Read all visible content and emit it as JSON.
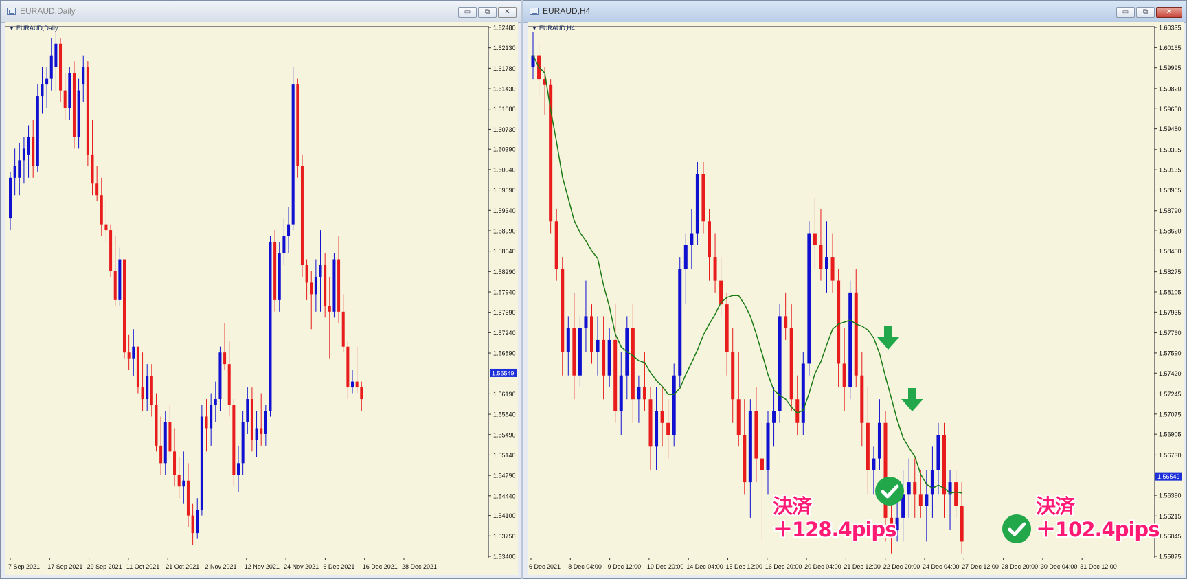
{
  "left_window": {
    "title": "EURAUD,Daily",
    "symbol_label": "EURAUD,Daily",
    "buttons": {
      "minimize": "▭",
      "maximize": "⧉",
      "close": "✕"
    }
  },
  "right_window": {
    "title": "EURAUD,H4",
    "symbol_label": "EURAUD,H4",
    "buttons": {
      "minimize": "▭",
      "maximize": "⧉",
      "close": "✕"
    }
  },
  "annotations": {
    "left": {
      "line1": "決済",
      "line2": "＋128.4pips"
    },
    "right": {
      "line1": "決済",
      "line2": "＋102.4pips"
    }
  },
  "colors": {
    "bull": "#1010d0",
    "bear": "#e81c1c",
    "ma": "#1a7a14",
    "bg": "#f6f4dc",
    "arrow": "#22a84a",
    "price_tag": "#1c2fd8"
  },
  "chart_data": [
    {
      "type": "candlestick",
      "title": "EURAUD,Daily",
      "current_price": "1.56549",
      "y_ticks": [
        "1.62480",
        "1.62130",
        "1.61780",
        "1.61430",
        "1.61080",
        "1.60730",
        "1.60390",
        "1.60040",
        "1.59690",
        "1.59340",
        "1.58990",
        "1.58640",
        "1.58290",
        "1.57940",
        "1.57590",
        "1.57240",
        "1.56890",
        "1.56549",
        "1.56190",
        "1.55840",
        "1.55490",
        "1.55140",
        "1.54790",
        "1.54440",
        "1.54100",
        "1.53750",
        "1.53400"
      ],
      "ylim": [
        1.534,
        1.6248
      ],
      "x_ticks": [
        "7 Sep 2021",
        "17 Sep 2021",
        "29 Sep 2021",
        "11 Oct 2021",
        "21 Oct 2021",
        "2 Nov 2021",
        "12 Nov 2021",
        "24 Nov 2021",
        "6 Dec 2021",
        "16 Dec 2021",
        "28 Dec 2021"
      ],
      "candles": [
        [
          1.592,
          1.6,
          1.59,
          1.599
        ],
        [
          1.599,
          1.604,
          1.596,
          1.601
        ],
        [
          1.599,
          1.605,
          1.596,
          1.602
        ],
        [
          1.602,
          1.606,
          1.598,
          1.604
        ],
        [
          1.603,
          1.608,
          1.599,
          1.606
        ],
        [
          1.606,
          1.609,
          1.599,
          1.601
        ],
        [
          1.601,
          1.615,
          1.6,
          1.613
        ],
        [
          1.613,
          1.618,
          1.61,
          1.615
        ],
        [
          1.615,
          1.618,
          1.611,
          1.616
        ],
        [
          1.616,
          1.623,
          1.614,
          1.62
        ],
        [
          1.618,
          1.624,
          1.614,
          1.622
        ],
        [
          1.622,
          1.623,
          1.612,
          1.614
        ],
        [
          1.614,
          1.617,
          1.609,
          1.611
        ],
        [
          1.611,
          1.618,
          1.609,
          1.617
        ],
        [
          1.617,
          1.619,
          1.604,
          1.606
        ],
        [
          1.606,
          1.616,
          1.604,
          1.614
        ],
        [
          1.615,
          1.62,
          1.612,
          1.618
        ],
        [
          1.618,
          1.619,
          1.601,
          1.603
        ],
        [
          1.603,
          1.609,
          1.596,
          1.598
        ],
        [
          1.598,
          1.601,
          1.595,
          1.596
        ],
        [
          1.596,
          1.599,
          1.589,
          1.591
        ],
        [
          1.591,
          1.595,
          1.588,
          1.59
        ],
        [
          1.59,
          1.591,
          1.582,
          1.583
        ],
        [
          1.583,
          1.589,
          1.577,
          1.578
        ],
        [
          1.578,
          1.587,
          1.577,
          1.585
        ],
        [
          1.585,
          1.585,
          1.568,
          1.569
        ],
        [
          1.569,
          1.572,
          1.566,
          1.568
        ],
        [
          1.568,
          1.573,
          1.565,
          1.57
        ],
        [
          1.57,
          1.57,
          1.562,
          1.563
        ],
        [
          1.563,
          1.569,
          1.559,
          1.561
        ],
        [
          1.561,
          1.567,
          1.559,
          1.565
        ],
        [
          1.565,
          1.567,
          1.558,
          1.56
        ],
        [
          1.56,
          1.562,
          1.552,
          1.553
        ],
        [
          1.553,
          1.558,
          1.548,
          1.55
        ],
        [
          1.55,
          1.559,
          1.548,
          1.557
        ],
        [
          1.557,
          1.56,
          1.551,
          1.552
        ],
        [
          1.552,
          1.556,
          1.546,
          1.548
        ],
        [
          1.548,
          1.551,
          1.544,
          1.546
        ],
        [
          1.546,
          1.552,
          1.543,
          1.547
        ],
        [
          1.547,
          1.55,
          1.539,
          1.541
        ],
        [
          1.541,
          1.543,
          1.536,
          1.538
        ],
        [
          1.538,
          1.544,
          1.537,
          1.542
        ],
        [
          1.542,
          1.56,
          1.541,
          1.558
        ],
        [
          1.558,
          1.561,
          1.552,
          1.556
        ],
        [
          1.556,
          1.562,
          1.553,
          1.56
        ],
        [
          1.56,
          1.564,
          1.557,
          1.561
        ],
        [
          1.561,
          1.57,
          1.559,
          1.569
        ],
        [
          1.569,
          1.574,
          1.566,
          1.567
        ],
        [
          1.567,
          1.571,
          1.558,
          1.56
        ],
        [
          1.56,
          1.561,
          1.546,
          1.548
        ],
        [
          1.548,
          1.553,
          1.545,
          1.55
        ],
        [
          1.55,
          1.559,
          1.548,
          1.557
        ],
        [
          1.557,
          1.563,
          1.555,
          1.561
        ],
        [
          1.561,
          1.563,
          1.552,
          1.554
        ],
        [
          1.554,
          1.559,
          1.551,
          1.556
        ],
        [
          1.556,
          1.562,
          1.553,
          1.555
        ],
        [
          1.555,
          1.56,
          1.553,
          1.559
        ],
        [
          1.559,
          1.589,
          1.558,
          1.588
        ],
        [
          1.588,
          1.59,
          1.576,
          1.578
        ],
        [
          1.578,
          1.588,
          1.576,
          1.586
        ],
        [
          1.586,
          1.592,
          1.584,
          1.589
        ],
        [
          1.589,
          1.594,
          1.586,
          1.591
        ],
        [
          1.591,
          1.618,
          1.59,
          1.615
        ],
        [
          1.615,
          1.616,
          1.599,
          1.601
        ],
        [
          1.601,
          1.603,
          1.582,
          1.584
        ],
        [
          1.584,
          1.585,
          1.578,
          1.581
        ],
        [
          1.581,
          1.583,
          1.573,
          1.579
        ],
        [
          1.579,
          1.585,
          1.576,
          1.582
        ],
        [
          1.582,
          1.59,
          1.576,
          1.584
        ],
        [
          1.584,
          1.586,
          1.575,
          1.577
        ],
        [
          1.577,
          1.582,
          1.568,
          1.576
        ],
        [
          1.576,
          1.586,
          1.575,
          1.585
        ],
        [
          1.585,
          1.589,
          1.574,
          1.576
        ],
        [
          1.576,
          1.579,
          1.569,
          1.57
        ],
        [
          1.57,
          1.571,
          1.561,
          1.563
        ],
        [
          1.563,
          1.566,
          1.562,
          1.564
        ],
        [
          1.564,
          1.57,
          1.562,
          1.563
        ],
        [
          1.563,
          1.564,
          1.559,
          1.561
        ]
      ]
    },
    {
      "type": "candlestick",
      "title": "EURAUD,H4",
      "current_price": "1.56549",
      "y_ticks": [
        "1.60335",
        "1.60165",
        "1.59995",
        "1.59820",
        "1.59650",
        "1.59480",
        "1.59305",
        "1.59135",
        "1.58965",
        "1.58790",
        "1.58620",
        "1.58450",
        "1.58275",
        "1.58105",
        "1.57935",
        "1.57760",
        "1.57590",
        "1.57420",
        "1.57245",
        "1.57075",
        "1.56905",
        "1.56730",
        "1.56549",
        "1.56390",
        "1.56215",
        "1.56045",
        "1.55875"
      ],
      "ylim": [
        1.55875,
        1.60335
      ],
      "x_ticks": [
        "6 Dec 2021",
        "8 Dec 04:00",
        "9 Dec 12:00",
        "10 Dec 20:00",
        "14 Dec 04:00",
        "15 Dec 12:00",
        "16 Dec 20:00",
        "20 Dec 04:00",
        "21 Dec 12:00",
        "22 Dec 20:00",
        "24 Dec 04:00",
        "27 Dec 12:00",
        "28 Dec 20:00",
        "30 Dec 04:00",
        "31 Dec 12:00"
      ],
      "ma_series": "MA",
      "candles": [
        [
          1.6,
          1.603,
          1.599,
          1.601
        ],
        [
          1.601,
          1.602,
          1.5975,
          1.599
        ],
        [
          1.599,
          1.6,
          1.596,
          1.5985
        ],
        [
          1.5985,
          1.599,
          1.586,
          1.587
        ],
        [
          1.587,
          1.588,
          1.582,
          1.583
        ],
        [
          1.583,
          1.584,
          1.574,
          1.576
        ],
        [
          1.576,
          1.579,
          1.574,
          1.578
        ],
        [
          1.578,
          1.581,
          1.572,
          1.574
        ],
        [
          1.574,
          1.579,
          1.573,
          1.578
        ],
        [
          1.578,
          1.582,
          1.576,
          1.579
        ],
        [
          1.579,
          1.58,
          1.575,
          1.576
        ],
        [
          1.576,
          1.579,
          1.574,
          1.577
        ],
        [
          1.577,
          1.579,
          1.572,
          1.574
        ],
        [
          1.574,
          1.578,
          1.573,
          1.577
        ],
        [
          1.577,
          1.58,
          1.57,
          1.571
        ],
        [
          1.571,
          1.576,
          1.569,
          1.574
        ],
        [
          1.574,
          1.579,
          1.572,
          1.578
        ],
        [
          1.578,
          1.58,
          1.57,
          1.572
        ],
        [
          1.572,
          1.574,
          1.57,
          1.573
        ],
        [
          1.573,
          1.576,
          1.571,
          1.572
        ],
        [
          1.572,
          1.573,
          1.566,
          1.568
        ],
        [
          1.568,
          1.573,
          1.566,
          1.571
        ],
        [
          1.571,
          1.573,
          1.568,
          1.57
        ],
        [
          1.57,
          1.572,
          1.567,
          1.569
        ],
        [
          1.569,
          1.575,
          1.568,
          1.574
        ],
        [
          1.574,
          1.584,
          1.573,
          1.583
        ],
        [
          1.583,
          1.586,
          1.58,
          1.585
        ],
        [
          1.585,
          1.588,
          1.583,
          1.586
        ],
        [
          1.586,
          1.592,
          1.585,
          1.591
        ],
        [
          1.591,
          1.592,
          1.586,
          1.587
        ],
        [
          1.587,
          1.588,
          1.582,
          1.584
        ],
        [
          1.584,
          1.586,
          1.581,
          1.582
        ],
        [
          1.582,
          1.584,
          1.579,
          1.58
        ],
        [
          1.58,
          1.581,
          1.574,
          1.576
        ],
        [
          1.576,
          1.578,
          1.57,
          1.572
        ],
        [
          1.572,
          1.576,
          1.568,
          1.569
        ],
        [
          1.569,
          1.572,
          1.564,
          1.565
        ],
        [
          1.565,
          1.572,
          1.562,
          1.571
        ],
        [
          1.571,
          1.573,
          1.565,
          1.567
        ],
        [
          1.567,
          1.57,
          1.56,
          1.566
        ],
        [
          1.566,
          1.571,
          1.564,
          1.57
        ],
        [
          1.57,
          1.573,
          1.568,
          1.571
        ],
        [
          1.571,
          1.58,
          1.57,
          1.579
        ],
        [
          1.579,
          1.581,
          1.577,
          1.578
        ],
        [
          1.578,
          1.58,
          1.571,
          1.572
        ],
        [
          1.572,
          1.574,
          1.569,
          1.57
        ],
        [
          1.57,
          1.576,
          1.569,
          1.575
        ],
        [
          1.575,
          1.587,
          1.574,
          1.586
        ],
        [
          1.586,
          1.589,
          1.583,
          1.585
        ],
        [
          1.585,
          1.588,
          1.582,
          1.583
        ],
        [
          1.583,
          1.587,
          1.581,
          1.584
        ],
        [
          1.584,
          1.586,
          1.581,
          1.582
        ],
        [
          1.582,
          1.583,
          1.573,
          1.575
        ],
        [
          1.575,
          1.578,
          1.571,
          1.573
        ],
        [
          1.573,
          1.582,
          1.572,
          1.581
        ],
        [
          1.581,
          1.583,
          1.573,
          1.574
        ],
        [
          1.574,
          1.576,
          1.568,
          1.57
        ],
        [
          1.57,
          1.573,
          1.564,
          1.566
        ],
        [
          1.566,
          1.568,
          1.564,
          1.567
        ],
        [
          1.567,
          1.572,
          1.566,
          1.57
        ],
        [
          1.57,
          1.571,
          1.56,
          1.562
        ],
        [
          1.562,
          1.564,
          1.559,
          1.561
        ],
        [
          1.561,
          1.565,
          1.56,
          1.562
        ],
        [
          1.562,
          1.566,
          1.56,
          1.564
        ],
        [
          1.564,
          1.567,
          1.562,
          1.565
        ],
        [
          1.565,
          1.567,
          1.562,
          1.564
        ],
        [
          1.564,
          1.566,
          1.562,
          1.563
        ],
        [
          1.563,
          1.566,
          1.56,
          1.564
        ],
        [
          1.564,
          1.568,
          1.562,
          1.566
        ],
        [
          1.566,
          1.57,
          1.564,
          1.569
        ],
        [
          1.569,
          1.57,
          1.562,
          1.564
        ],
        [
          1.564,
          1.566,
          1.561,
          1.565
        ],
        [
          1.565,
          1.566,
          1.562,
          1.563
        ],
        [
          1.563,
          1.565,
          1.559,
          1.56
        ]
      ]
    }
  ]
}
